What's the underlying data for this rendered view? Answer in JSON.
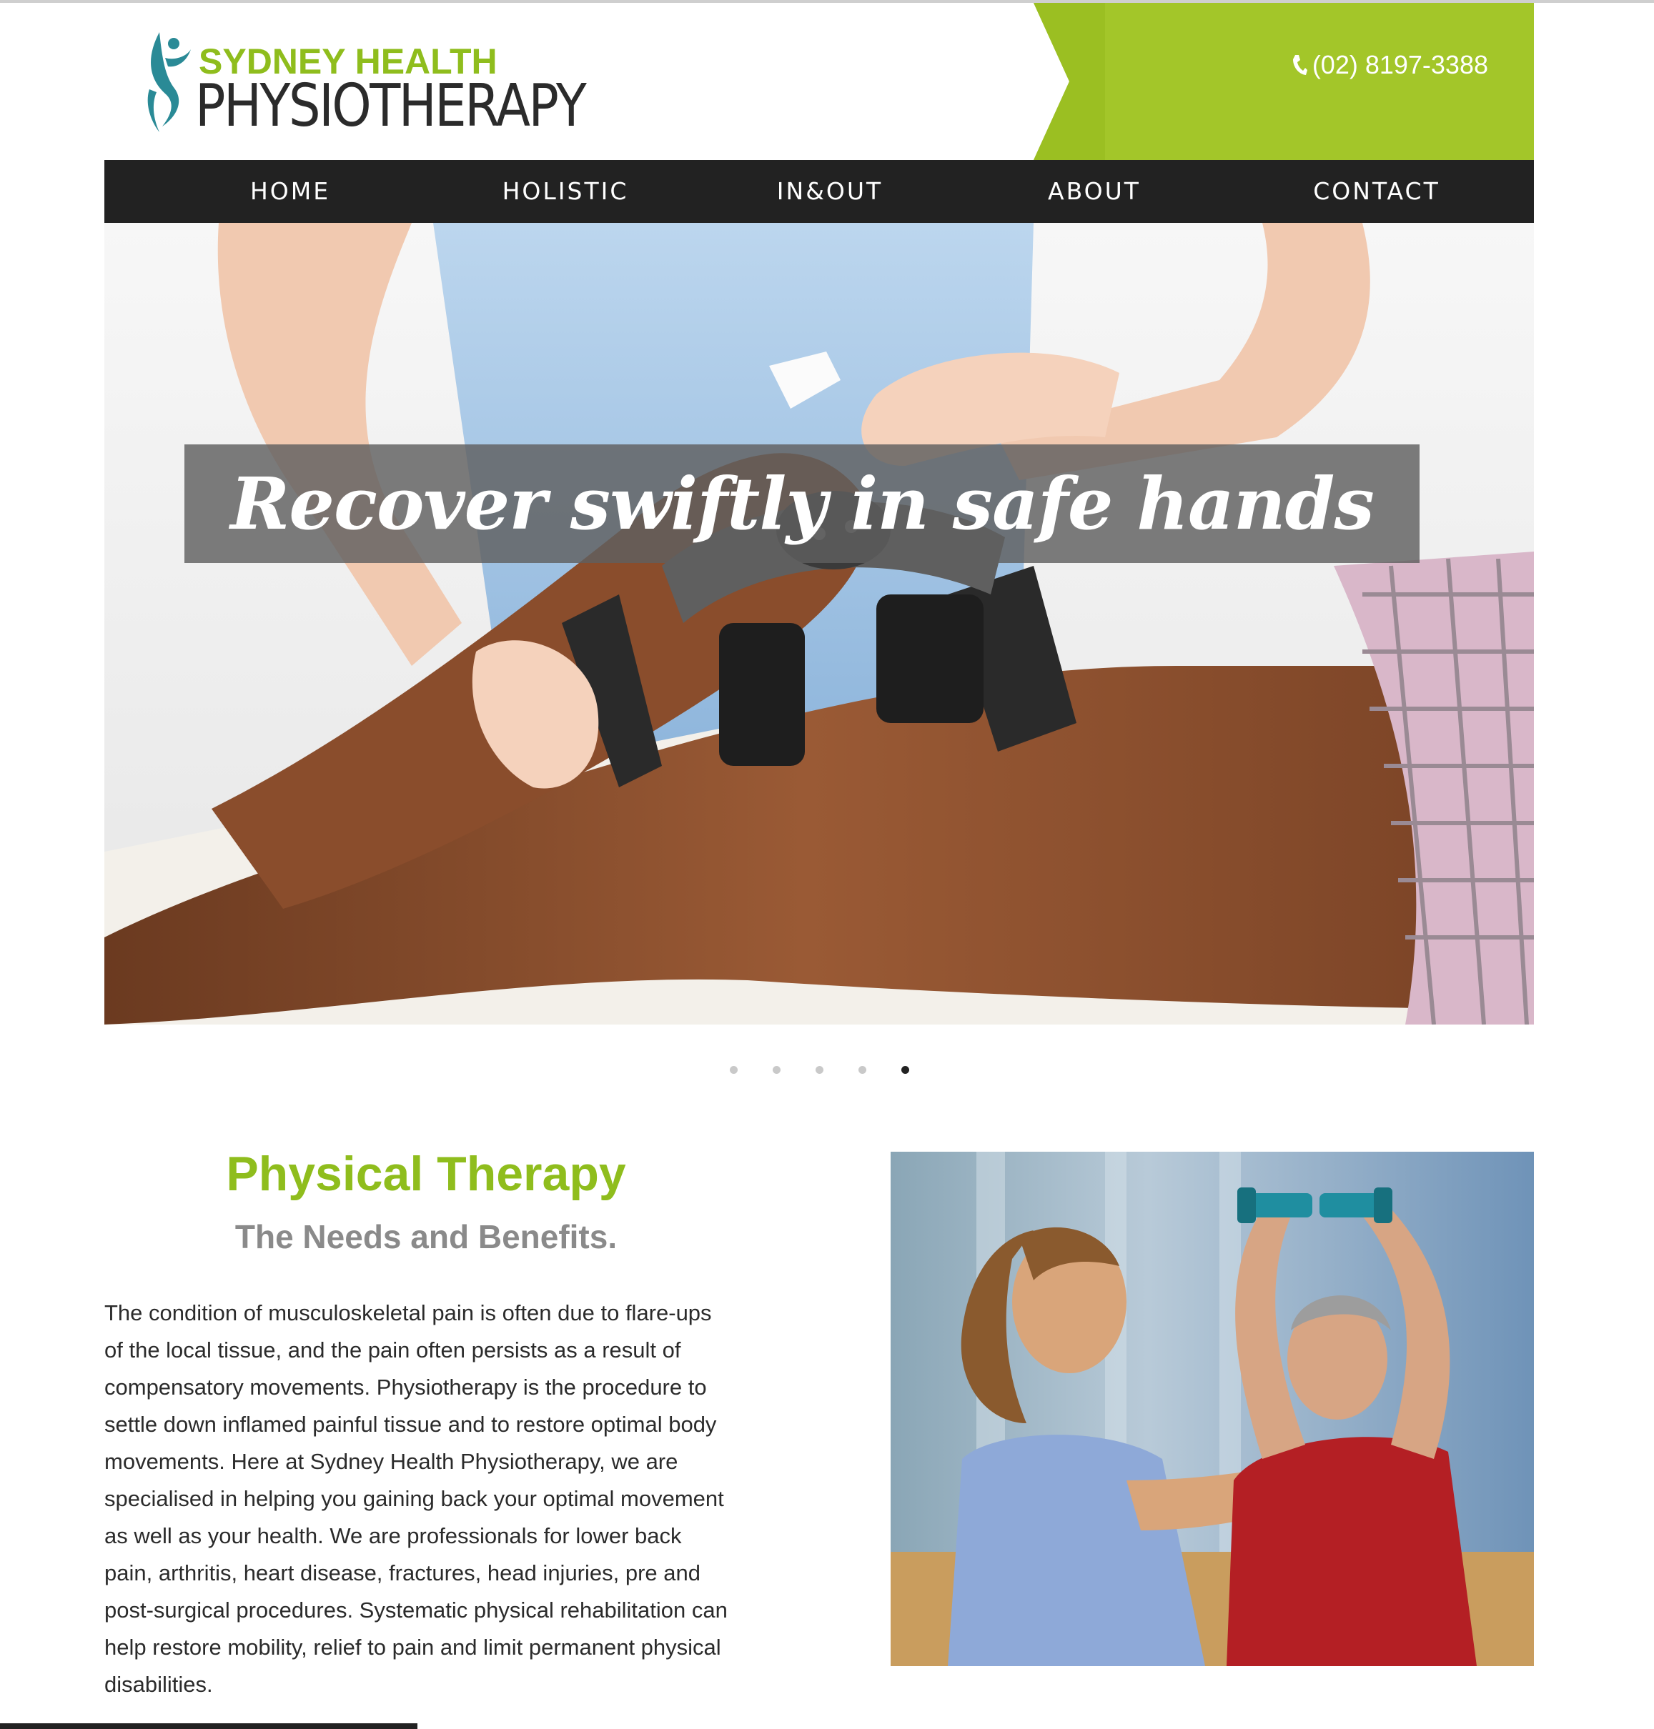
{
  "brand": {
    "name_line1": "SYDNEY HEALTH",
    "name_line2": "PHYSIOTHERAPY",
    "green": "#8fbd1d",
    "dark": "#2b2b2b",
    "teal": "#2a8a96"
  },
  "header": {
    "phone": "(02) 8197-3388",
    "phone_icon": "phone-icon"
  },
  "nav": {
    "items": [
      {
        "label": "HOME"
      },
      {
        "label": "HOLISTIC"
      },
      {
        "label": "IN&OUT"
      },
      {
        "label": "ABOUT"
      },
      {
        "label": "CONTACT"
      }
    ]
  },
  "hero": {
    "caption": "Recover swiftly   in safe hands",
    "slides_total": 5,
    "active_slide": 5
  },
  "main": {
    "title": "Physical Therapy",
    "subtitle": "The Needs and Benefits.",
    "body_lines": [
      "The condition of musculoskeletal pain is often due to flare-ups",
      "of the local tissue, and the pain often persists as a result of",
      "compensatory movements. Physiotherapy is the procedure to",
      "settle down inflamed painful tissue and to restore optimal body",
      "movements. Here at Sydney Health Physiotherapy, we are",
      "specialised in helping you gaining back your optimal movement",
      "as well as your health. We are professionals for lower back",
      "pain, arthritis, heart disease, fractures, head injuries, pre and",
      "post-surgical procedures. Systematic physical rehabilitation can",
      "help restore mobility, relief to pain and limit permanent physical",
      "disabilities."
    ]
  }
}
